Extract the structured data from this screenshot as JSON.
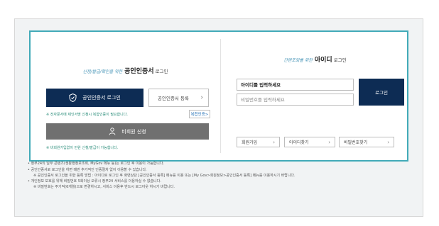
{
  "left": {
    "title_prefix": "신청/발급/확인을 위한",
    "title_main": "공인인증서",
    "title_suffix": "로그인",
    "cert_login_label": "공인인증서 로그인",
    "cert_register_label": "공인인증서 등록",
    "cert_note": "※ 전자문서에 제인서명 신청시 복합인증이 필요합니다.",
    "dup_cert_label": "복합인증>",
    "nonmember_label": "비회원 신청",
    "nonmember_note": "※ 비회원가입없이 민원 신청/발급이 가능합니다."
  },
  "right": {
    "title_prefix": "간편조회를 위한",
    "title_main": "아이디",
    "title_suffix": "로그인",
    "id_placeholder": "아이디를 입력하세요",
    "pw_placeholder": "비밀번호를 입력하세요",
    "login_label": "로그인",
    "join_label": "회원가입",
    "find_id_label": "아이디찾기",
    "find_pw_label": "비밀번호찾기"
  },
  "notes": [
    "• 정부24의 일부 콘텐츠(생활행정보조회, MyGov 메뉴 등)는 로그인 후 이용이 가능합니다.",
    "• 공인인증서로 로그인을 하면 매번 추가적인 인증절차 없이 이용할 수 있습니다.",
    "※ 공인인증서 로그인을 위한 등록 방법 : 아이디로 로그인 후 화면상단 [공인인증서 등록] 메뉴를 이용 또는 [My Gov>회원정보>공인인증서 등록] 메뉴를 이용하시기 바랍니다.",
    "• 개인정보 보호를 위해 비밀번호 5회이상 오류시 정부24 서비스를 이용하실 수 없습니다.",
    "※ 비밀번호는 주기적(6개월)으로 변경하시고, 서비스 이용후 반드시 로그아웃 하시기 바랍니다."
  ],
  "icons": {
    "cert_login": "shield-check-icon",
    "nonmember": "person-icon",
    "chevron": "chevron-right-icon"
  },
  "colors": {
    "accent_border": "#41aab8",
    "primary_button": "#0d2c54",
    "secondary_button": "#707070",
    "note_text": "#2a8d7a"
  }
}
